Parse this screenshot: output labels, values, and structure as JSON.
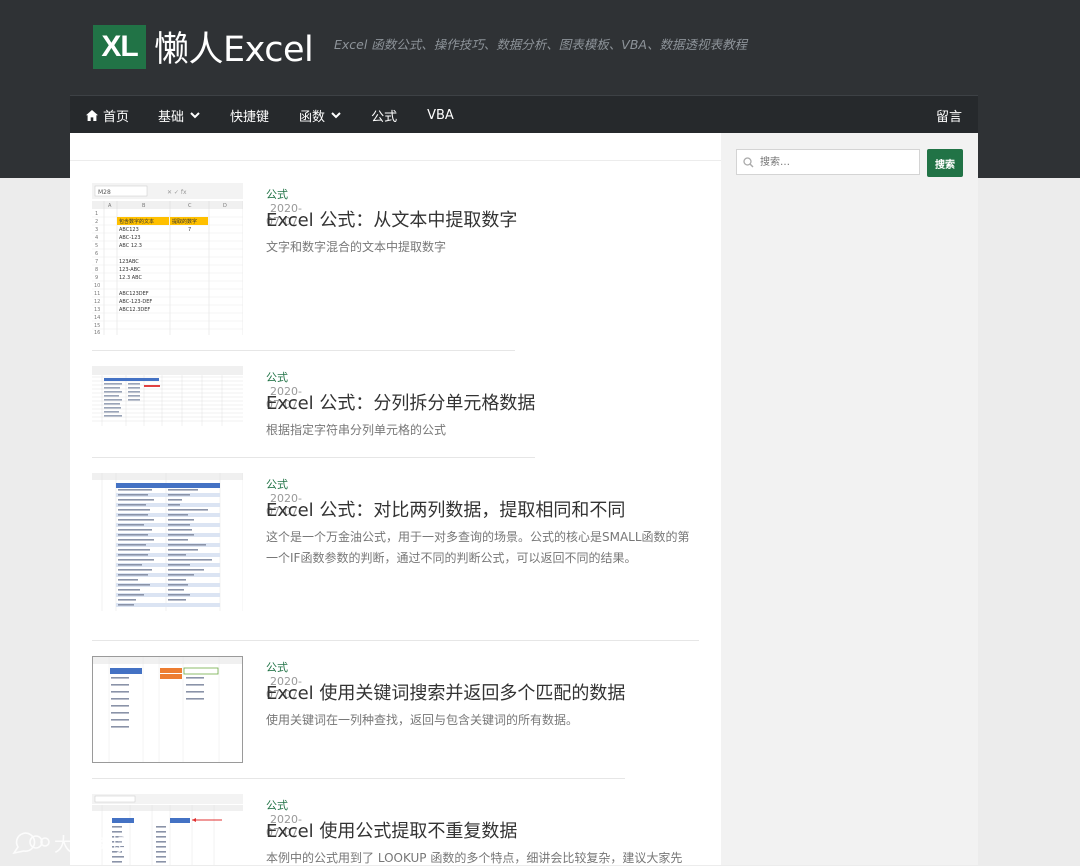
{
  "site": {
    "logo_badge": "XL",
    "logo_text": "懒人Excel",
    "tagline": "Excel 函数公式、操作技巧、数据分析、图表模板、VBA、数据透视表教程"
  },
  "nav": {
    "items": [
      {
        "label": "首页",
        "icon": "home-icon"
      },
      {
        "label": "基础",
        "dropdown": true
      },
      {
        "label": "快捷键"
      },
      {
        "label": "函数",
        "dropdown": true
      },
      {
        "label": "公式"
      },
      {
        "label": "VBA"
      }
    ],
    "right": "留言"
  },
  "search": {
    "placeholder": "搜索…",
    "button": "搜索"
  },
  "posts": [
    {
      "category": "公式",
      "date": "2020-07-07",
      "title": "Excel 公式：从文本中提取数字",
      "excerpt": "文字和数字混合的文本中提取数字"
    },
    {
      "category": "公式",
      "date": "2020-07-07",
      "title": "Excel 公式：分列拆分单元格数据",
      "excerpt": "根据指定字符串分列单元格的公式"
    },
    {
      "category": "公式",
      "date": "2020-07-07",
      "title": "Excel 公式：对比两列数据，提取相同和不同",
      "excerpt": "这个是一个万金油公式，用于一对多查询的场景。公式的核心是SMALL函数的第一个IF函数参数的判断，通过不同的判断公式，可以返回不同的结果。"
    },
    {
      "category": "公式",
      "date": "2020-07-07",
      "title": "Excel 使用关键词搜索并返回多个匹配的数据",
      "excerpt": "使用关键词在一列种查找，返回与包含关键词的所有数据。"
    },
    {
      "category": "公式",
      "date": "2020-07-07",
      "title": "Excel 使用公式提取不重复数据",
      "excerpt": "本例中的公式用到了 LOOKUP 函数的多个特点，细讲会比较复杂，建议大家先"
    }
  ],
  "thumb1": {
    "namebox": "M28",
    "header1": "包含数字的文本",
    "header2": "提取的数字",
    "rows": [
      "ABC123",
      "ABC-123",
      "ABC 12.3",
      "",
      "123ABC",
      "123-ABC",
      "12.3 ABC",
      "",
      "ABC123DEF",
      "ABC-123-DEF",
      "ABC12.3DEF"
    ],
    "result1": "7"
  },
  "watermark": "大数跨境",
  "colors": {
    "accent": "#217346",
    "header": "#2f3235",
    "nav": "#26292c"
  }
}
